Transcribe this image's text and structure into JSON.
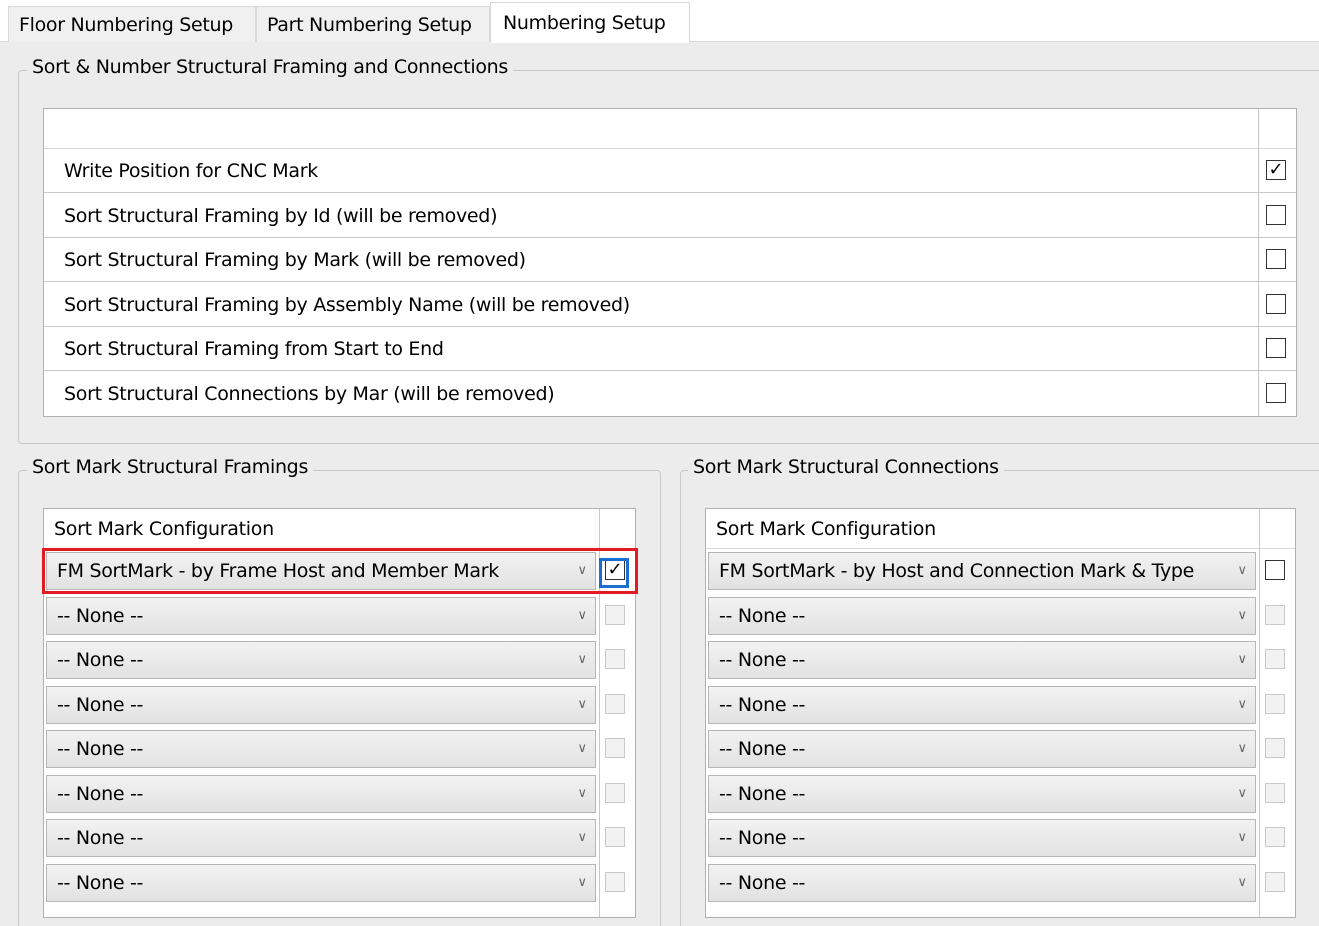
{
  "tabs": [
    {
      "label": "Floor Numbering Setup",
      "active": false
    },
    {
      "label": "Part Numbering Setup",
      "active": false
    },
    {
      "label": "Numbering Setup",
      "active": true
    }
  ],
  "sort_number_group": {
    "title": "Sort & Number Structural Framing and Connections",
    "rows": [
      {
        "label": "Write Position for CNC Mark",
        "checked": true
      },
      {
        "label": "Sort Structural Framing by Id (will be removed)",
        "checked": false
      },
      {
        "label": "Sort Structural Framing by Mark (will be removed)",
        "checked": false
      },
      {
        "label": "Sort Structural Framing by Assembly Name (will be removed)",
        "checked": false
      },
      {
        "label": "Sort Structural Framing from Start to End",
        "checked": false
      },
      {
        "label": "Sort Structural Connections by Mar (will be removed)",
        "checked": false
      }
    ]
  },
  "framings_group": {
    "title": "Sort Mark Structural Framings",
    "column_header": "Sort Mark Configuration",
    "rows": [
      {
        "value": "FM SortMark - by Frame Host and Member Mark",
        "checked": true
      },
      {
        "value": "-- None --",
        "checked": false
      },
      {
        "value": "-- None --",
        "checked": false
      },
      {
        "value": "-- None --",
        "checked": false
      },
      {
        "value": "-- None --",
        "checked": false
      },
      {
        "value": "-- None --",
        "checked": false
      },
      {
        "value": "-- None --",
        "checked": false
      },
      {
        "value": "-- None --",
        "checked": false
      }
    ]
  },
  "connections_group": {
    "title": "Sort Mark Structural Connections",
    "column_header": "Sort Mark Configuration",
    "rows": [
      {
        "value": "FM SortMark - by Host and Connection Mark & Type",
        "checked": false
      },
      {
        "value": "-- None --",
        "checked": false
      },
      {
        "value": "-- None --",
        "checked": false
      },
      {
        "value": "-- None --",
        "checked": false
      },
      {
        "value": "-- None --",
        "checked": false
      },
      {
        "value": "-- None --",
        "checked": false
      },
      {
        "value": "-- None --",
        "checked": false
      },
      {
        "value": "-- None --",
        "checked": false
      }
    ]
  },
  "icons": {
    "check": "✓",
    "chevron": "chevron-down-icon"
  },
  "colors": {
    "highlight": "#e01b24",
    "focus": "#1a6fd1"
  }
}
